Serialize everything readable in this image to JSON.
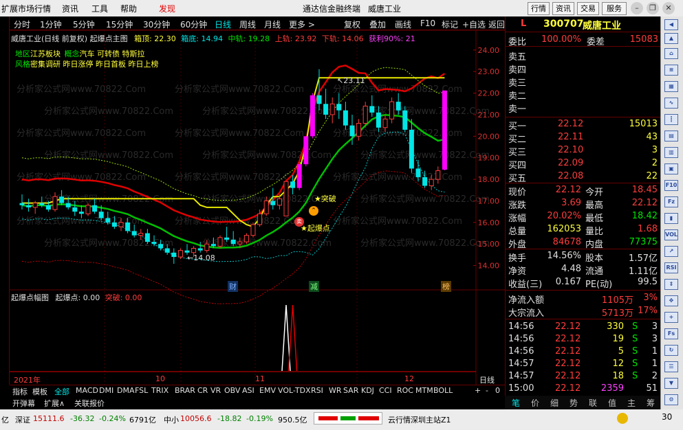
{
  "top_menu": {
    "items": [
      "扩展市场行情",
      "资讯",
      "工具",
      "帮助",
      "发现"
    ],
    "center_title": "通达信金融终端",
    "stock_title": "威唐工业",
    "right_buttons": [
      "行情",
      "资讯",
      "交易",
      "服务"
    ]
  },
  "period_bar": {
    "items": [
      "分时",
      "1分钟",
      "5分钟",
      "15分钟",
      "30分钟",
      "60分钟",
      "日线",
      "周线",
      "月线",
      "更多 >"
    ],
    "active": "日线",
    "right_tabs": [
      "复权",
      "叠加",
      "画线",
      "F10",
      "标记",
      "+自选",
      "返回"
    ]
  },
  "main_chart_header": {
    "title": "威唐工业(日线 前复权) 起爆点主图",
    "box_top": "箱顶: 22.30",
    "box_bottom": "箱底: 14.94",
    "mid_rail": "中轨: 19.28",
    "upper_rail": "上轨: 23.92",
    "lower_rail": "下轨: 14.06",
    "profit": "获利90%: 21",
    "region_label": "地区",
    "region_value": "江苏板块",
    "concept_label": "概念",
    "concept_value": "汽车 可转债 特斯拉",
    "style_label": "风格",
    "style_value": "密集调研 昨日涨停 昨日首板 昨日上榜"
  },
  "annotations": {
    "high": "23.11",
    "low": "14.08",
    "breakout": "突破",
    "ignition": "起爆点",
    "event_caip": "财",
    "event_jian": "减",
    "event_bang": "榜"
  },
  "price_axis": [
    "24.00",
    "23.00",
    "22.00",
    "21.00",
    "20.00",
    "19.00",
    "18.00",
    "17.00",
    "16.00",
    "15.00",
    "14.00"
  ],
  "sub_chart_header": {
    "title": "起爆点幅图",
    "ignition": "起爆点: 0.00",
    "breakout": "突破: 0.00"
  },
  "date_axis": [
    "2021年",
    "10",
    "11",
    "12"
  ],
  "indicator_tabs": [
    "指标",
    "模板",
    "全部",
    "MACD",
    "DMI",
    "DMA",
    "FSL",
    "TRIX",
    "BRAR",
    "CR",
    "VR",
    "OBV",
    "ASI",
    "EMV",
    "VOL-TDX",
    "RSI",
    "WR",
    "SAR",
    "KDJ",
    "CCI",
    "ROC",
    "MTM",
    "BOLL"
  ],
  "indicator_tail": [
    "+",
    "-",
    "0"
  ],
  "bottom_buttons": [
    "开弹幕",
    "扩展∧",
    "关联报价"
  ],
  "period_label": "日线",
  "quote": {
    "badge": "L",
    "code": "300707",
    "name": "威唐工业",
    "weibi_label": "委比",
    "weibi": "100.00%",
    "weicha_label": "委差",
    "weicha": "15083",
    "sell": [
      {
        "label": "卖五",
        "price": "",
        "vol": ""
      },
      {
        "label": "卖四",
        "price": "",
        "vol": ""
      },
      {
        "label": "卖三",
        "price": "",
        "vol": ""
      },
      {
        "label": "卖二",
        "price": "",
        "vol": ""
      },
      {
        "label": "卖一",
        "price": "",
        "vol": ""
      }
    ],
    "buy": [
      {
        "label": "买一",
        "price": "22.12",
        "vol": "15013"
      },
      {
        "label": "买二",
        "price": "22.11",
        "vol": "43"
      },
      {
        "label": "买三",
        "price": "22.10",
        "vol": "3"
      },
      {
        "label": "买四",
        "price": "22.09",
        "vol": "2"
      },
      {
        "label": "买五",
        "price": "22.08",
        "vol": "22"
      }
    ],
    "stats": [
      {
        "l1": "现价",
        "v1": "22.12",
        "c1": "r",
        "l2": "今开",
        "v2": "18.45",
        "c2": "r"
      },
      {
        "l1": "涨跌",
        "v1": "3.69",
        "c1": "r",
        "l2": "最高",
        "v2": "22.12",
        "c2": "r"
      },
      {
        "l1": "涨幅",
        "v1": "20.02%",
        "c1": "r",
        "l2": "最低",
        "v2": "18.42",
        "c2": "g"
      },
      {
        "l1": "总量",
        "v1": "162053",
        "c1": "y",
        "l2": "量比",
        "v2": "1.68",
        "c2": "r"
      },
      {
        "l1": "外盘",
        "v1": "84678",
        "c1": "r",
        "l2": "内盘",
        "v2": "77375",
        "c2": "g"
      }
    ],
    "stats2": [
      {
        "l1": "换手",
        "v1": "14.56%",
        "l2": "股本",
        "v2": "1.57亿"
      },
      {
        "l1": "净资",
        "v1": "4.48",
        "l2": "流通",
        "v2": "1.11亿"
      },
      {
        "l1": "收益(三)",
        "v1": "0.167",
        "l2": "PE(动)",
        "v2": "99.5"
      }
    ],
    "flow": [
      {
        "label": "净流入额",
        "value": "1105万",
        "pct": "3%"
      },
      {
        "label": "大宗流入",
        "value": "5713万",
        "pct": "17%"
      }
    ],
    "ticks": [
      {
        "time": "14:56",
        "price": "22.12",
        "vol": "330",
        "side": "S",
        "n": "3"
      },
      {
        "time": "14:56",
        "price": "22.12",
        "vol": "19",
        "side": "S",
        "n": "3"
      },
      {
        "time": "14:56",
        "price": "22.12",
        "vol": "5",
        "side": "S",
        "n": "1"
      },
      {
        "time": "14:57",
        "price": "22.12",
        "vol": "12",
        "side": "S",
        "n": "1"
      },
      {
        "time": "14:57",
        "price": "22.12",
        "vol": "18",
        "side": "S",
        "n": "2"
      },
      {
        "time": "15:00",
        "price": "22.12",
        "vol": "2359",
        "side": "",
        "n": "51"
      }
    ],
    "tabs": [
      "笔",
      "价",
      "细",
      "势",
      "联",
      "值",
      "主",
      "筹"
    ]
  },
  "status_bar": {
    "prefix": "亿",
    "sz_label": "深证",
    "sz_value": "15111.6",
    "sz_change": "-36.32",
    "sz_pct": "-0.24%",
    "sz_amount": "6791亿",
    "zx_label": "中小",
    "zx_value": "10056.6",
    "zx_change": "-18.82",
    "zx_pct": "-0.19%",
    "zx_amount": "950.5亿",
    "server": "云行情深圳主站Z1",
    "right_num": "30"
  },
  "watermark": "分析家公式网www.70822.Com",
  "colors": {
    "up": "#ff3c3c",
    "down": "#00e5e5",
    "upper": "#e00000",
    "mid": "#00c000",
    "ma": "#e8e800",
    "spike": "#ff00ff"
  },
  "chart_data": {
    "type": "candlestick",
    "price_range": [
      13.7,
      24.6
    ],
    "candles": [
      {
        "o": 16.9,
        "h": 17.3,
        "l": 16.6,
        "c": 16.8
      },
      {
        "o": 16.8,
        "h": 17.1,
        "l": 16.5,
        "c": 16.7
      },
      {
        "o": 16.7,
        "h": 17.0,
        "l": 16.4,
        "c": 16.9
      },
      {
        "o": 16.9,
        "h": 17.2,
        "l": 16.7,
        "c": 16.8
      },
      {
        "o": 16.8,
        "h": 17.0,
        "l": 16.5,
        "c": 16.6
      },
      {
        "o": 16.6,
        "h": 17.4,
        "l": 16.5,
        "c": 17.2
      },
      {
        "o": 17.2,
        "h": 17.5,
        "l": 16.8,
        "c": 16.9
      },
      {
        "o": 16.9,
        "h": 17.2,
        "l": 16.6,
        "c": 16.7
      },
      {
        "o": 16.7,
        "h": 17.0,
        "l": 16.3,
        "c": 16.5
      },
      {
        "o": 16.5,
        "h": 16.8,
        "l": 16.2,
        "c": 16.4
      },
      {
        "o": 16.4,
        "h": 16.9,
        "l": 16.3,
        "c": 16.8
      },
      {
        "o": 16.8,
        "h": 17.1,
        "l": 16.4,
        "c": 16.5
      },
      {
        "o": 16.5,
        "h": 16.8,
        "l": 16.1,
        "c": 16.2
      },
      {
        "o": 16.2,
        "h": 16.5,
        "l": 15.9,
        "c": 16.0
      },
      {
        "o": 16.0,
        "h": 16.3,
        "l": 15.7,
        "c": 15.8
      },
      {
        "o": 15.8,
        "h": 16.2,
        "l": 15.6,
        "c": 16.0
      },
      {
        "o": 16.0,
        "h": 16.2,
        "l": 15.5,
        "c": 15.6
      },
      {
        "o": 15.6,
        "h": 15.9,
        "l": 15.3,
        "c": 15.4
      },
      {
        "o": 15.4,
        "h": 15.7,
        "l": 15.2,
        "c": 15.5
      },
      {
        "o": 15.5,
        "h": 15.7,
        "l": 15.0,
        "c": 15.1
      },
      {
        "o": 15.1,
        "h": 15.4,
        "l": 14.9,
        "c": 15.0
      },
      {
        "o": 15.0,
        "h": 15.2,
        "l": 14.7,
        "c": 14.8
      },
      {
        "o": 14.8,
        "h": 15.0,
        "l": 14.5,
        "c": 14.6
      },
      {
        "o": 14.6,
        "h": 14.8,
        "l": 14.08,
        "c": 14.4
      },
      {
        "o": 14.4,
        "h": 14.8,
        "l": 14.3,
        "c": 14.7
      },
      {
        "o": 14.7,
        "h": 15.0,
        "l": 14.5,
        "c": 14.6
      },
      {
        "o": 14.6,
        "h": 14.9,
        "l": 14.4,
        "c": 14.8
      },
      {
        "o": 14.8,
        "h": 15.1,
        "l": 14.6,
        "c": 14.7
      },
      {
        "o": 14.7,
        "h": 15.2,
        "l": 14.6,
        "c": 15.0
      },
      {
        "o": 15.0,
        "h": 15.3,
        "l": 14.8,
        "c": 14.9
      },
      {
        "o": 14.9,
        "h": 15.4,
        "l": 14.8,
        "c": 15.3
      },
      {
        "o": 15.3,
        "h": 15.8,
        "l": 15.1,
        "c": 15.2
      },
      {
        "o": 15.2,
        "h": 15.6,
        "l": 14.9,
        "c": 15.0
      },
      {
        "o": 15.0,
        "h": 15.3,
        "l": 14.8,
        "c": 15.1
      },
      {
        "o": 15.1,
        "h": 15.5,
        "l": 15.0,
        "c": 15.4
      },
      {
        "o": 15.4,
        "h": 16.0,
        "l": 15.3,
        "c": 15.9
      },
      {
        "o": 15.9,
        "h": 16.6,
        "l": 15.8,
        "c": 16.4
      },
      {
        "o": 16.4,
        "h": 17.2,
        "l": 16.3,
        "c": 17.0
      },
      {
        "o": 17.0,
        "h": 17.6,
        "l": 16.6,
        "c": 16.8
      },
      {
        "o": 16.8,
        "h": 17.3,
        "l": 16.6,
        "c": 17.1
      },
      {
        "o": 16.3,
        "h": 17.9,
        "l": 16.3,
        "c": 17.9
      },
      {
        "o": 17.9,
        "h": 18.2,
        "l": 17.3,
        "c": 17.6
      },
      {
        "o": 17.6,
        "h": 18.8,
        "l": 17.5,
        "c": 18.7
      },
      {
        "o": 18.7,
        "h": 20.0,
        "l": 18.6,
        "c": 20.0
      },
      {
        "o": 20.0,
        "h": 22.0,
        "l": 19.9,
        "c": 21.9
      },
      {
        "o": 21.9,
        "h": 23.11,
        "l": 21.2,
        "c": 21.5
      },
      {
        "o": 21.5,
        "h": 22.2,
        "l": 20.8,
        "c": 21.0
      },
      {
        "o": 21.0,
        "h": 21.8,
        "l": 20.6,
        "c": 21.5
      },
      {
        "o": 21.5,
        "h": 22.0,
        "l": 20.8,
        "c": 21.2
      },
      {
        "o": 21.2,
        "h": 21.6,
        "l": 20.3,
        "c": 20.5
      },
      {
        "o": 20.5,
        "h": 21.0,
        "l": 19.6,
        "c": 20.0
      },
      {
        "o": 20.0,
        "h": 20.8,
        "l": 19.8,
        "c": 20.6
      },
      {
        "o": 20.6,
        "h": 21.6,
        "l": 20.4,
        "c": 21.4
      },
      {
        "o": 21.4,
        "h": 21.9,
        "l": 20.9,
        "c": 21.1
      },
      {
        "o": 21.1,
        "h": 21.4,
        "l": 20.2,
        "c": 20.4
      },
      {
        "o": 20.4,
        "h": 21.0,
        "l": 20.2,
        "c": 20.8
      },
      {
        "o": 20.8,
        "h": 21.8,
        "l": 20.6,
        "c": 21.6
      },
      {
        "o": 21.6,
        "h": 22.0,
        "l": 21.0,
        "c": 21.2
      },
      {
        "o": 21.2,
        "h": 21.4,
        "l": 20.2,
        "c": 20.3
      },
      {
        "o": 20.3,
        "h": 20.8,
        "l": 18.3,
        "c": 18.5
      },
      {
        "o": 18.5,
        "h": 18.9,
        "l": 17.9,
        "c": 18.1
      },
      {
        "o": 18.1,
        "h": 18.4,
        "l": 17.6,
        "c": 17.7
      },
      {
        "o": 17.7,
        "h": 18.2,
        "l": 17.5,
        "c": 18.0
      },
      {
        "o": 18.0,
        "h": 18.6,
        "l": 17.8,
        "c": 18.4
      },
      {
        "o": 18.45,
        "h": 22.12,
        "l": 18.42,
        "c": 22.12
      }
    ]
  }
}
